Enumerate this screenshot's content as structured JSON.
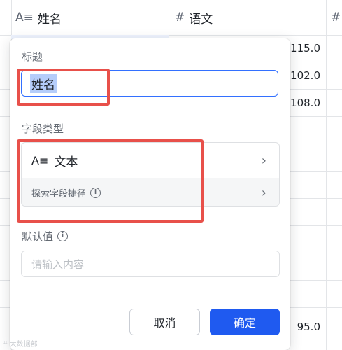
{
  "sheet": {
    "columns": [
      {
        "icon": "text-type-icon",
        "glyph": "A≡",
        "label": "姓名"
      },
      {
        "icon": "number-type-icon",
        "glyph": "#",
        "label": "语文"
      },
      {
        "icon": "number-type-icon",
        "glyph": "#",
        "label": ""
      }
    ],
    "values": [
      "115.0",
      "102.0",
      "108.0",
      "95.0"
    ]
  },
  "popover": {
    "title_label": "标题",
    "title_value": "姓名",
    "field_type_label": "字段类型",
    "field_type": {
      "icon": "text-type-icon",
      "glyph": "A≡",
      "value": "文本"
    },
    "shortcut_label": "探索字段捷径",
    "default_label": "默认值",
    "default_placeholder": "请输入内容",
    "cancel_label": "取消",
    "confirm_label": "确定"
  },
  "watermark": "大数据部",
  "colors": {
    "accent": "#1f5af0",
    "input_focus": "#3370ff",
    "annotation": "#e8504a"
  }
}
